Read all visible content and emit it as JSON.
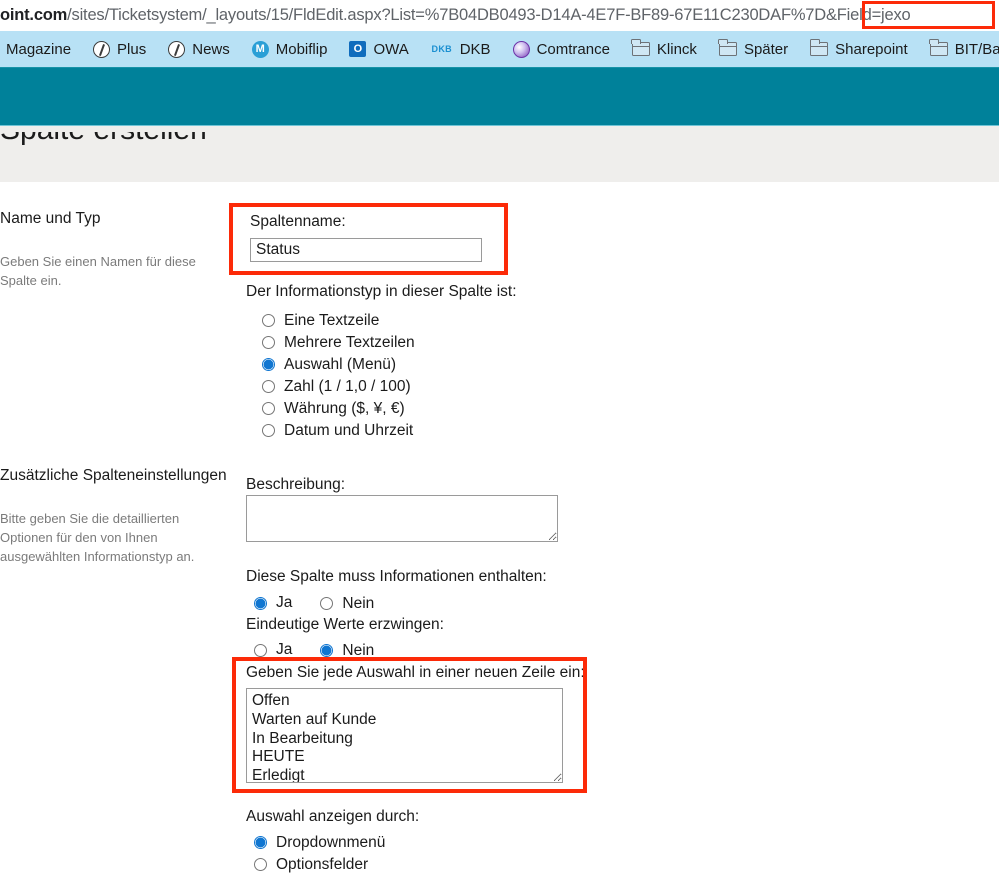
{
  "browser": {
    "url_host": "oint.com",
    "url_path": "/sites/Ticketsystem/_layouts/15/FldEdit.aspx?List=%7B04DB0493-D14A-4E7F-BF89-67E11C230DAF%7D&Field=jexo",
    "url_highlight_fragment": "D&Field=jexo",
    "bookmarks": [
      {
        "label": "Magazine",
        "icon": "none"
      },
      {
        "label": "Plus",
        "icon": "circle-slash-icon"
      },
      {
        "label": "News",
        "icon": "circle-slash-icon"
      },
      {
        "label": "Mobiflip",
        "icon": "mobiflip-icon"
      },
      {
        "label": "OWA",
        "icon": "outlook-icon"
      },
      {
        "label": "DKB",
        "icon": "dkb-icon"
      },
      {
        "label": "Comtrance",
        "icon": "comtrance-icon"
      },
      {
        "label": "Klinck",
        "icon": "folder-icon"
      },
      {
        "label": "Später",
        "icon": "folder-icon"
      },
      {
        "label": "Sharepoint",
        "icon": "folder-icon"
      },
      {
        "label": "BIT/Barm",
        "icon": "folder-icon"
      }
    ]
  },
  "theme": {
    "bookmark_bar_bg": "#b8e1f5",
    "site_header_teal": "#00819a",
    "page_band_gray": "#efeeec",
    "highlight_red": "#fc2a08",
    "radio_blue": "#1076d1"
  },
  "page_title_clipped": "Spalte erstellen",
  "sections": {
    "name_and_type": {
      "heading": "Name und Typ",
      "description": "Geben Sie einen Namen für diese Spalte ein.",
      "column_name_label": "Spaltenname:",
      "column_name_value": "Status",
      "type_label": "Der Informationstyp in dieser Spalte ist:",
      "type_options": [
        {
          "label": "Eine Textzeile",
          "selected": false
        },
        {
          "label": "Mehrere Textzeilen",
          "selected": false
        },
        {
          "label": "Auswahl (Menü)",
          "selected": true
        },
        {
          "label": "Zahl (1 / 1,0 / 100)",
          "selected": false
        },
        {
          "label": "Währung ($, ¥, €)",
          "selected": false
        },
        {
          "label": "Datum und Uhrzeit",
          "selected": false
        }
      ]
    },
    "additional_settings": {
      "heading": "Zusätzliche Spalteneinstellungen",
      "description": "Bitte geben Sie die detaillierten Optionen für den von Ihnen ausgewählten Informationstyp an.",
      "description_label": "Beschreibung:",
      "description_value": "",
      "required_label": "Diese Spalte muss Informationen enthalten:",
      "required_options": [
        {
          "label": "Ja",
          "selected": true
        },
        {
          "label": "Nein",
          "selected": false
        }
      ],
      "unique_label": "Eindeutige Werte erzwingen:",
      "unique_options": [
        {
          "label": "Ja",
          "selected": false
        },
        {
          "label": "Nein",
          "selected": true
        }
      ],
      "choices_label": "Geben Sie jede Auswahl in einer neuen Zeile ein:",
      "choices_value": "Offen\nWarten auf Kunde\nIn Bearbeitung\nHEUTE\nErledigt",
      "display_label": "Auswahl anzeigen durch:",
      "display_options": [
        {
          "label": "Dropdownmenü",
          "selected": true
        },
        {
          "label": "Optionsfelder",
          "selected": false
        }
      ]
    }
  }
}
